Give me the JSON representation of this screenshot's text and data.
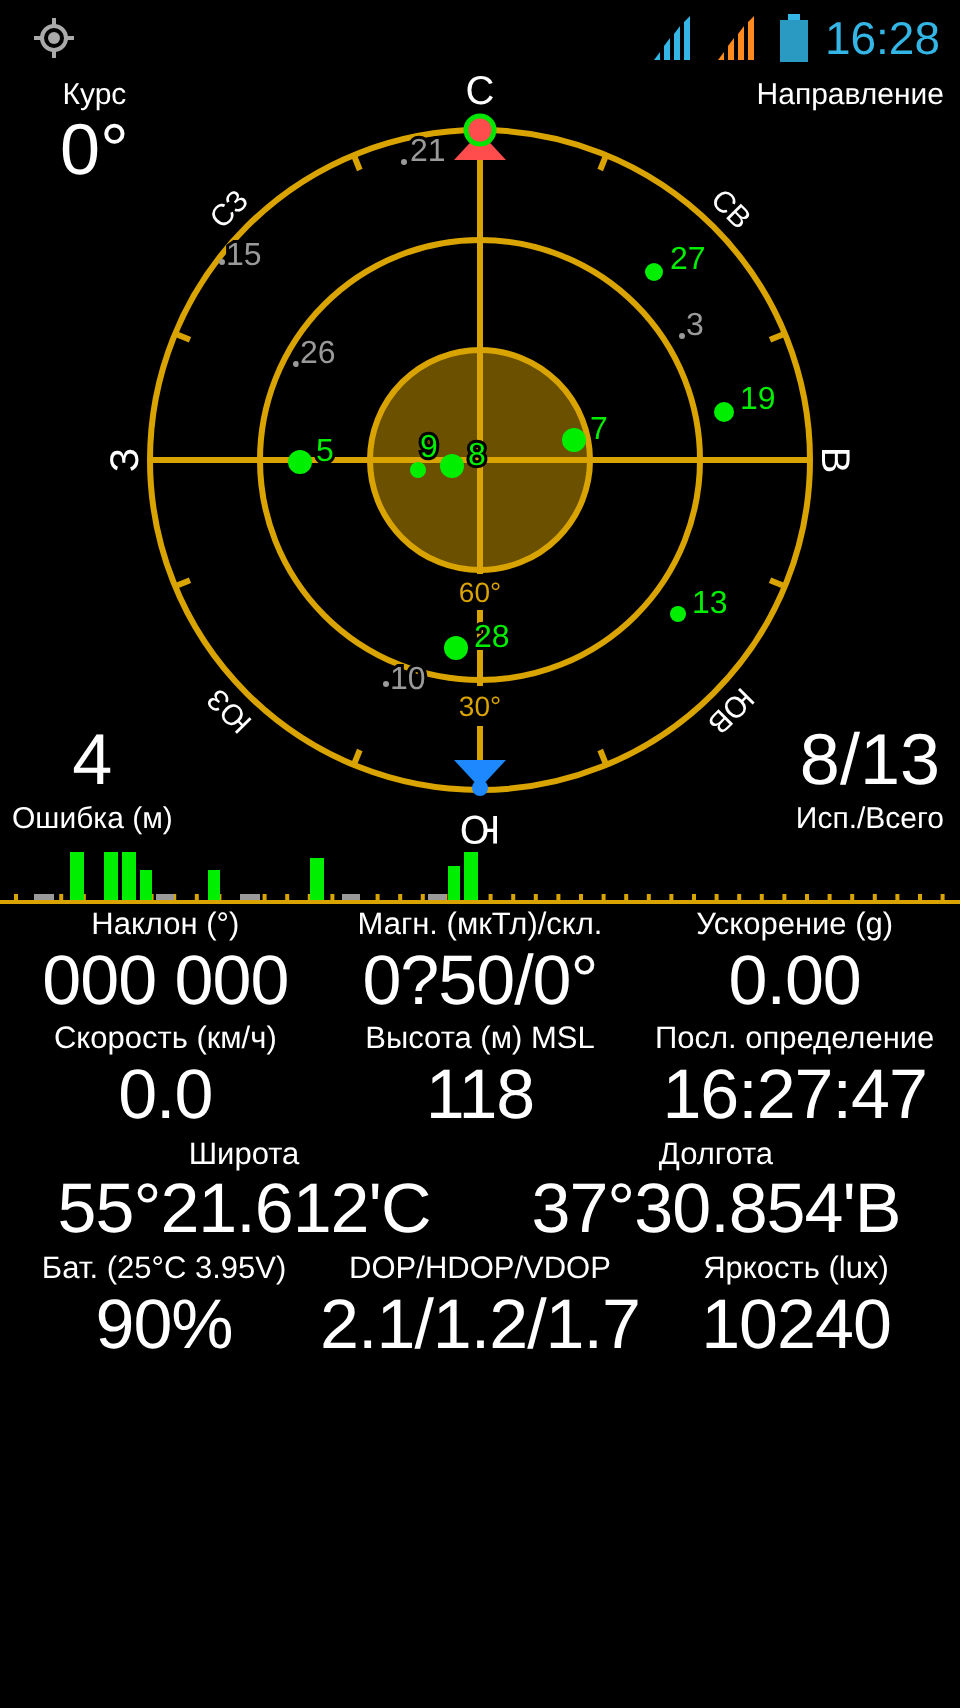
{
  "status_bar": {
    "time": "16:28"
  },
  "course": {
    "label": "Курс",
    "value": "0°"
  },
  "direction": {
    "label": "Направление"
  },
  "compass": {
    "labels": [
      "С",
      "СВ",
      "В",
      "ЮВ",
      "Ю",
      "ЮЗ",
      "З",
      "СЗ"
    ],
    "elevations": [
      "60°",
      "30°"
    ]
  },
  "satellites": [
    {
      "number": "21",
      "used": false
    },
    {
      "number": "27",
      "used": true
    },
    {
      "number": "15",
      "used": false
    },
    {
      "number": "26",
      "used": false
    },
    {
      "number": "3",
      "used": false
    },
    {
      "number": "19",
      "used": true
    },
    {
      "number": "5",
      "used": true
    },
    {
      "number": "9",
      "used": true
    },
    {
      "number": "8",
      "used": true
    },
    {
      "number": "7",
      "used": true
    },
    {
      "number": "13",
      "used": true
    },
    {
      "number": "28",
      "used": true
    },
    {
      "number": "10",
      "used": false
    }
  ],
  "error": {
    "value": "4",
    "label": "Ошибка (м)"
  },
  "satellite_count": {
    "value": "8/13",
    "label": "Исп./Всего"
  },
  "readings": [
    [
      {
        "label": "Наклон (°)",
        "value": "000 000"
      },
      {
        "label": "Магн. (мкТл)/скл.",
        "value": "0?50/0°"
      },
      {
        "label": "Ускорение (g)",
        "value": "0.00"
      }
    ],
    [
      {
        "label": "Скорость (км/ч)",
        "value": "0.0"
      },
      {
        "label": "Высота (м) MSL",
        "value": "118"
      },
      {
        "label": "Посл. определение",
        "value": "16:27:47"
      }
    ],
    [
      {
        "label": "Широта",
        "value": "55°21.612'С"
      },
      {
        "label": "Долгота",
        "value": "37°30.854'В"
      }
    ],
    [
      {
        "label": "Бат. (25°C 3.95V)",
        "value": "90%"
      },
      {
        "label": "DOP/HDOP/VDOP",
        "value": "2.1/1.2/1.7"
      },
      {
        "label": "Яркость (lux)",
        "value": "10240"
      }
    ]
  ]
}
